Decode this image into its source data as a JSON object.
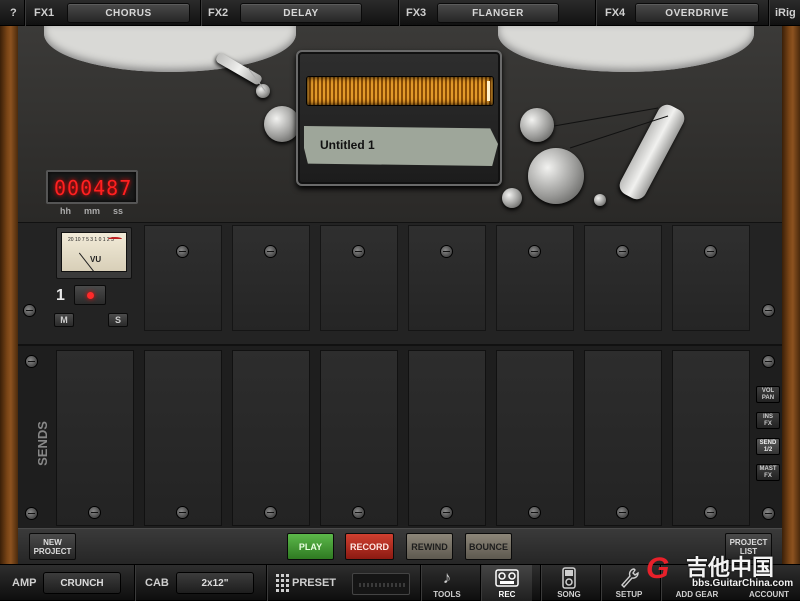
{
  "fx": [
    {
      "label": "FX1",
      "effect": "CHORUS"
    },
    {
      "label": "FX2",
      "effect": "DELAY"
    },
    {
      "label": "FX3",
      "effect": "FLANGER"
    },
    {
      "label": "FX4",
      "effect": "OVERDRIVE"
    }
  ],
  "header": {
    "help": "?",
    "brand": "iRig"
  },
  "recorder": {
    "project_name": "Untitled 1",
    "counter": "000487",
    "units": [
      "hh",
      "mm",
      "ss"
    ]
  },
  "track": {
    "number": "1",
    "vu_label": "VU",
    "vu_scale": "20 10 7 5 3 1 0 1 2 3",
    "mute": "M",
    "solo": "S",
    "armed": true
  },
  "sends": {
    "label": "SENDS",
    "side_buttons": [
      {
        "line1": "VOL",
        "line2": "PAN",
        "selected": false
      },
      {
        "line1": "INS",
        "line2": "FX",
        "selected": false
      },
      {
        "line1": "SEND",
        "line2": "1/2",
        "selected": true
      },
      {
        "line1": "MAST",
        "line2": "FX",
        "selected": false
      }
    ]
  },
  "transport": {
    "new_project_1": "NEW",
    "new_project_2": "PROJECT",
    "play": "PLAY",
    "record": "RECORD",
    "rewind": "REWIND",
    "bounce": "BOUNCE",
    "project_list_1": "PROJECT",
    "project_list_2": "LIST"
  },
  "tabbar": {
    "amp_label": "AMP",
    "amp_value": "CRUNCH",
    "cab_label": "CAB",
    "cab_value": "2x12\"",
    "preset_label": "PRESET",
    "tabs": [
      {
        "label": "TOOLS",
        "icon": "guitar-icon"
      },
      {
        "label": "REC",
        "icon": "tape-recorder-icon"
      },
      {
        "label": "SONG",
        "icon": "ipod-icon"
      },
      {
        "label": "SETUP",
        "icon": "wrench-icon"
      },
      {
        "label": "ADD GEAR",
        "icon": "plus-icon"
      },
      {
        "label": "ACCOUNT",
        "icon": "account-icon"
      }
    ],
    "selected_tab": "REC"
  },
  "watermark": {
    "chinese": "吉他中国",
    "url": "bbs.GuitarChina.com"
  },
  "colors": {
    "accent_play": "#3f9a30",
    "accent_record": "#b02a1e",
    "counter_led": "#ff2020"
  }
}
